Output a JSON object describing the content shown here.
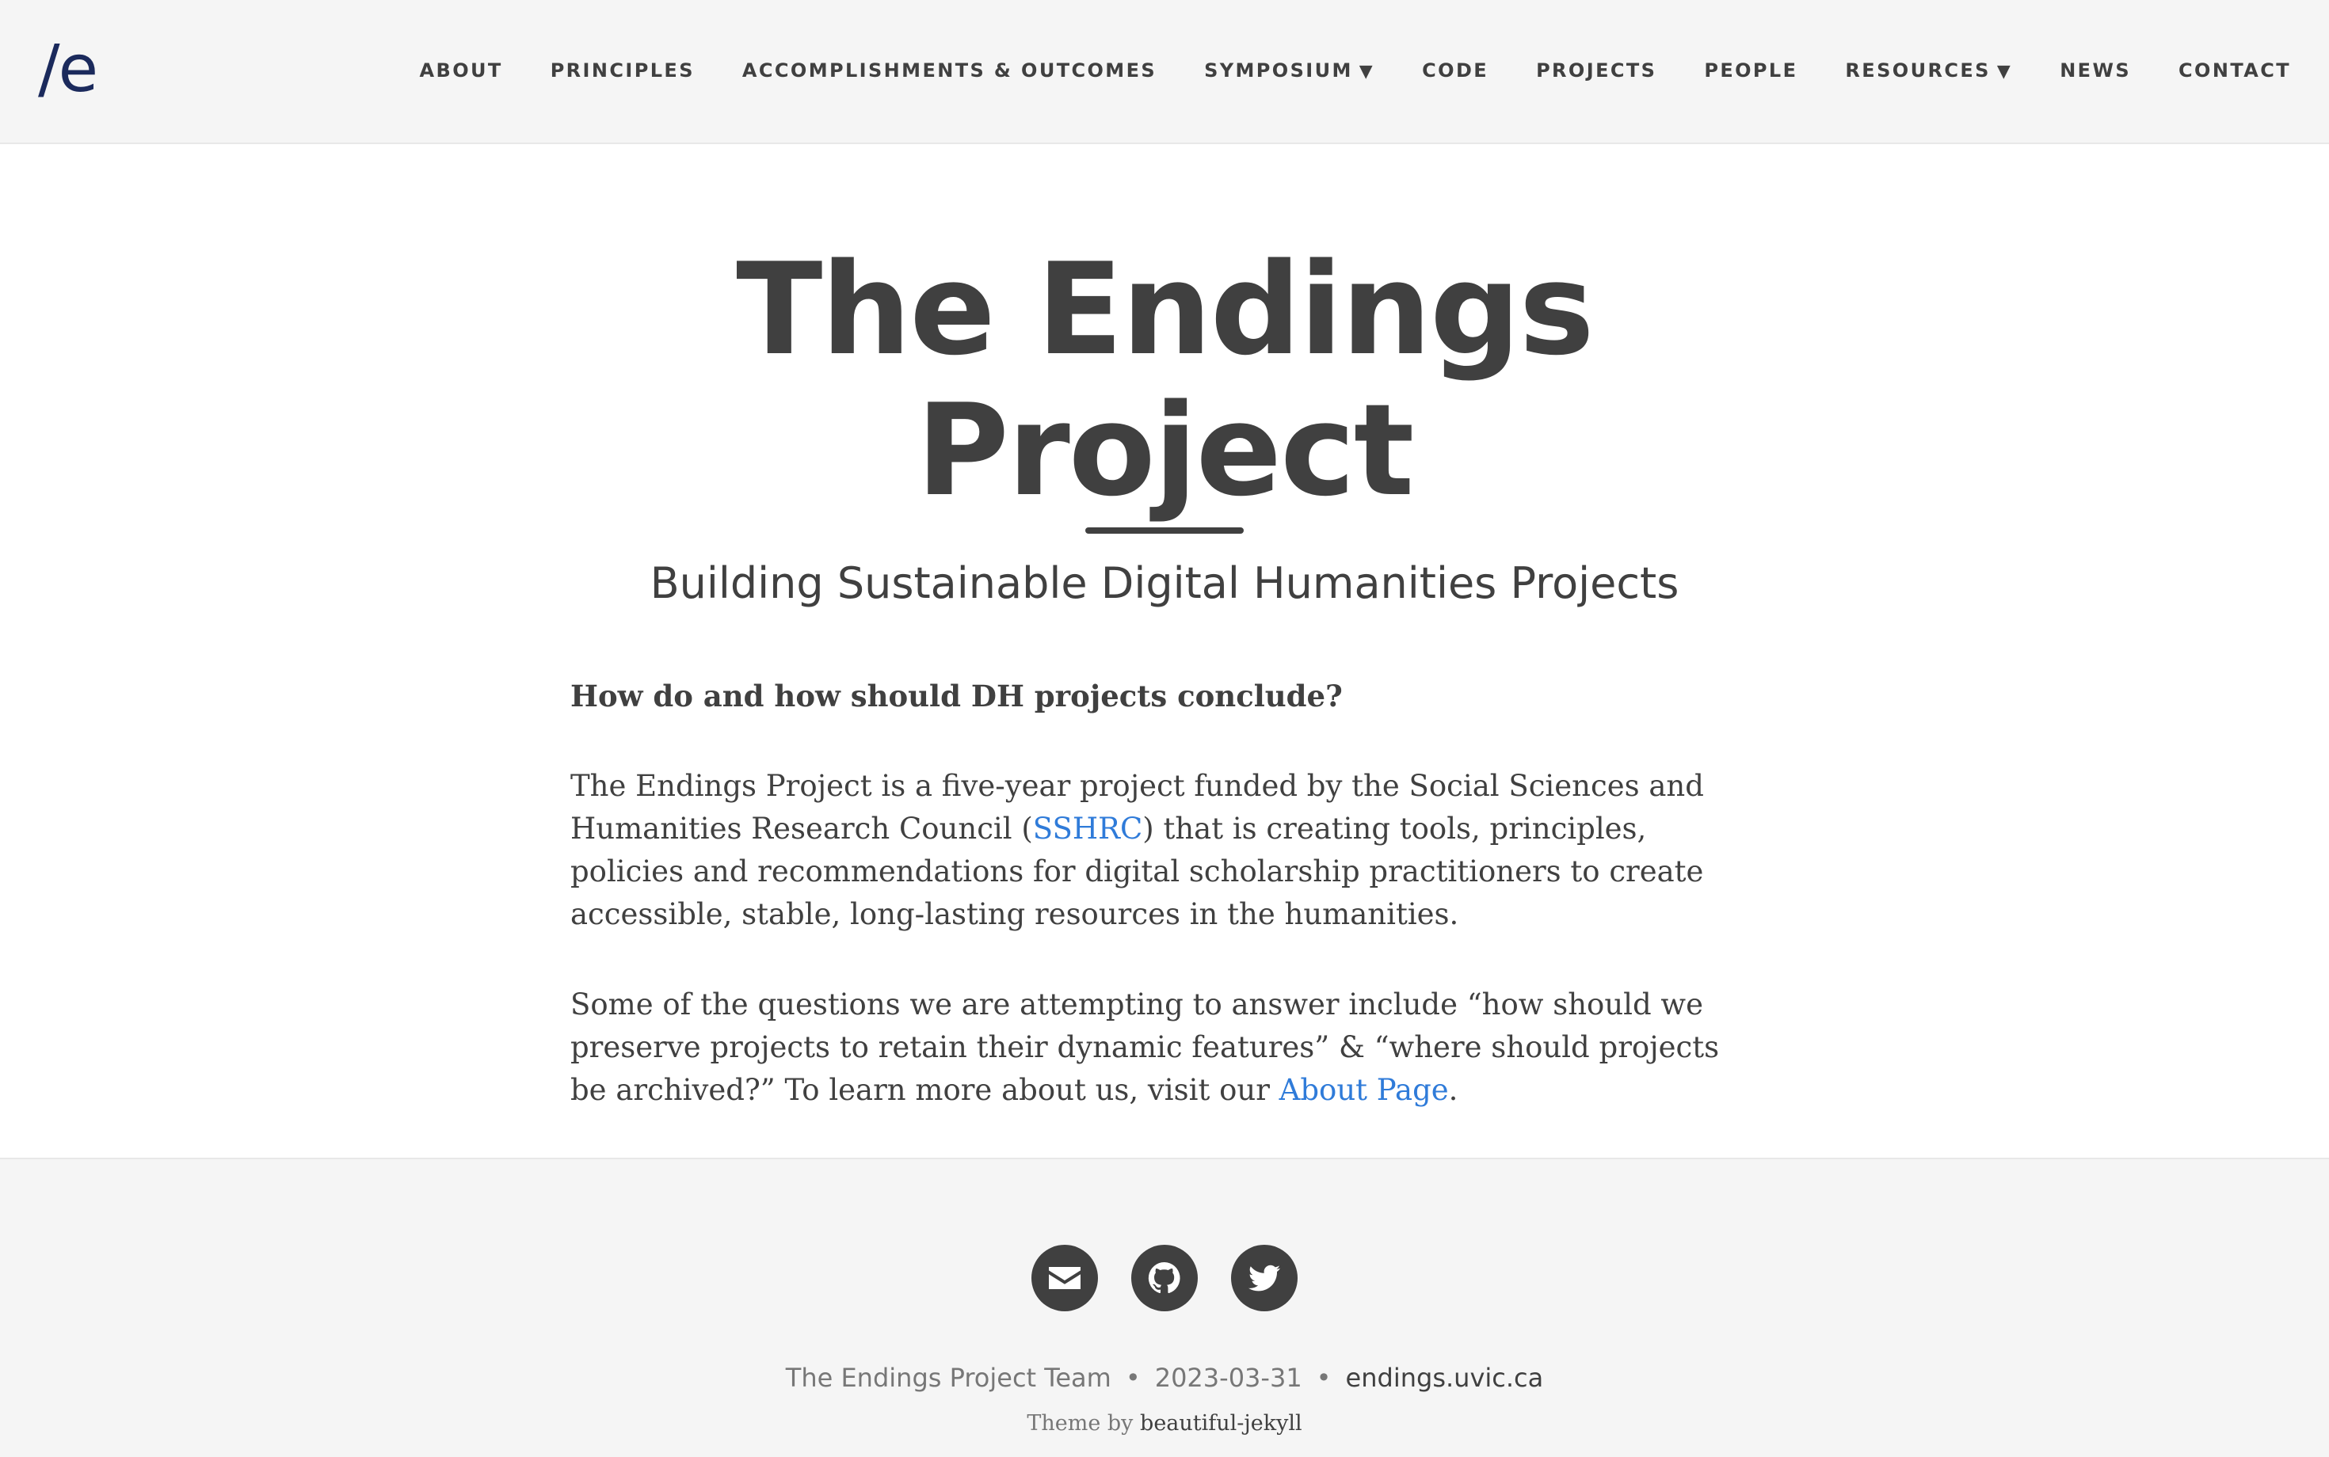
{
  "navbar": {
    "brand": "/e",
    "items": [
      {
        "label": "ABOUT"
      },
      {
        "label": "PRINCIPLES"
      },
      {
        "label": "ACCOMPLISHMENTS & OUTCOMES"
      },
      {
        "label": "SYMPOSIUM",
        "caret": "▼"
      },
      {
        "label": "CODE"
      },
      {
        "label": "PROJECTS"
      },
      {
        "label": "PEOPLE"
      },
      {
        "label": "RESOURCES",
        "caret": "▼"
      },
      {
        "label": "NEWS"
      },
      {
        "label": "CONTACT"
      }
    ]
  },
  "header": {
    "title_line1": "The Endings",
    "title_line2": "Project",
    "subtitle": "Building Sustainable Digital Humanities Projects"
  },
  "content": {
    "question": "How do and how should DH projects conclude?",
    "p1_before": "The Endings Project is a five-year project funded by the Social Sciences and Humanities Research Council (",
    "p1_link": "SSHRC",
    "p1_after": ") that is creating tools, principles, policies and recommendations for digital scholarship practitioners to create accessible, stable, long-lasting resources in the humanities.",
    "p2_before": "Some of the questions we are attempting to answer include “how should we preserve projects to retain their dynamic features” & “where should projects be archived?” To learn more about us, visit our ",
    "p2_link": "About Page",
    "p2_after": "."
  },
  "footer": {
    "social_icons": [
      "envelope-icon",
      "github-icon",
      "twitter-icon"
    ],
    "author": "The Endings Project Team",
    "separator": "•",
    "date": "2023-03-31",
    "site": "endings.uvic.ca",
    "theme_prefix": "Theme by ",
    "theme_link": "beautiful-jekyll"
  },
  "colors": {
    "nav_bg": "#f5f5f5",
    "text": "#404040",
    "link": "#2f7bd9",
    "brand": "#1b2a5c",
    "muted": "#777777"
  }
}
